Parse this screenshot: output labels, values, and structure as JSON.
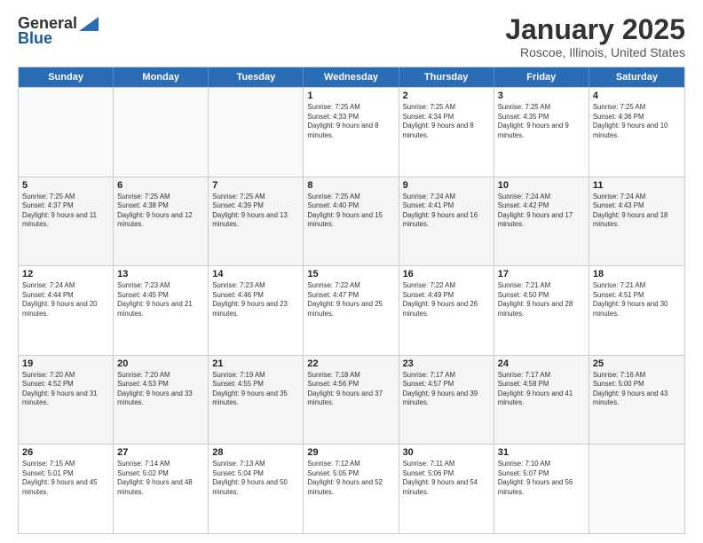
{
  "logo": {
    "general": "General",
    "blue": "Blue"
  },
  "title": "January 2025",
  "subtitle": "Roscoe, Illinois, United States",
  "headers": [
    "Sunday",
    "Monday",
    "Tuesday",
    "Wednesday",
    "Thursday",
    "Friday",
    "Saturday"
  ],
  "weeks": [
    [
      {
        "day": "",
        "sunrise": "",
        "sunset": "",
        "daylight": "",
        "empty": true
      },
      {
        "day": "",
        "sunrise": "",
        "sunset": "",
        "daylight": "",
        "empty": true
      },
      {
        "day": "",
        "sunrise": "",
        "sunset": "",
        "daylight": "",
        "empty": true
      },
      {
        "day": "1",
        "sunrise": "Sunrise: 7:25 AM",
        "sunset": "Sunset: 4:33 PM",
        "daylight": "Daylight: 9 hours and 8 minutes.",
        "empty": false
      },
      {
        "day": "2",
        "sunrise": "Sunrise: 7:25 AM",
        "sunset": "Sunset: 4:34 PM",
        "daylight": "Daylight: 9 hours and 8 minutes.",
        "empty": false
      },
      {
        "day": "3",
        "sunrise": "Sunrise: 7:25 AM",
        "sunset": "Sunset: 4:35 PM",
        "daylight": "Daylight: 9 hours and 9 minutes.",
        "empty": false
      },
      {
        "day": "4",
        "sunrise": "Sunrise: 7:25 AM",
        "sunset": "Sunset: 4:36 PM",
        "daylight": "Daylight: 9 hours and 10 minutes.",
        "empty": false
      }
    ],
    [
      {
        "day": "5",
        "sunrise": "Sunrise: 7:25 AM",
        "sunset": "Sunset: 4:37 PM",
        "daylight": "Daylight: 9 hours and 11 minutes.",
        "empty": false
      },
      {
        "day": "6",
        "sunrise": "Sunrise: 7:25 AM",
        "sunset": "Sunset: 4:38 PM",
        "daylight": "Daylight: 9 hours and 12 minutes.",
        "empty": false
      },
      {
        "day": "7",
        "sunrise": "Sunrise: 7:25 AM",
        "sunset": "Sunset: 4:39 PM",
        "daylight": "Daylight: 9 hours and 13 minutes.",
        "empty": false
      },
      {
        "day": "8",
        "sunrise": "Sunrise: 7:25 AM",
        "sunset": "Sunset: 4:40 PM",
        "daylight": "Daylight: 9 hours and 15 minutes.",
        "empty": false
      },
      {
        "day": "9",
        "sunrise": "Sunrise: 7:24 AM",
        "sunset": "Sunset: 4:41 PM",
        "daylight": "Daylight: 9 hours and 16 minutes.",
        "empty": false
      },
      {
        "day": "10",
        "sunrise": "Sunrise: 7:24 AM",
        "sunset": "Sunset: 4:42 PM",
        "daylight": "Daylight: 9 hours and 17 minutes.",
        "empty": false
      },
      {
        "day": "11",
        "sunrise": "Sunrise: 7:24 AM",
        "sunset": "Sunset: 4:43 PM",
        "daylight": "Daylight: 9 hours and 18 minutes.",
        "empty": false
      }
    ],
    [
      {
        "day": "12",
        "sunrise": "Sunrise: 7:24 AM",
        "sunset": "Sunset: 4:44 PM",
        "daylight": "Daylight: 9 hours and 20 minutes.",
        "empty": false
      },
      {
        "day": "13",
        "sunrise": "Sunrise: 7:23 AM",
        "sunset": "Sunset: 4:45 PM",
        "daylight": "Daylight: 9 hours and 21 minutes.",
        "empty": false
      },
      {
        "day": "14",
        "sunrise": "Sunrise: 7:23 AM",
        "sunset": "Sunset: 4:46 PM",
        "daylight": "Daylight: 9 hours and 23 minutes.",
        "empty": false
      },
      {
        "day": "15",
        "sunrise": "Sunrise: 7:22 AM",
        "sunset": "Sunset: 4:47 PM",
        "daylight": "Daylight: 9 hours and 25 minutes.",
        "empty": false
      },
      {
        "day": "16",
        "sunrise": "Sunrise: 7:22 AM",
        "sunset": "Sunset: 4:49 PM",
        "daylight": "Daylight: 9 hours and 26 minutes.",
        "empty": false
      },
      {
        "day": "17",
        "sunrise": "Sunrise: 7:21 AM",
        "sunset": "Sunset: 4:50 PM",
        "daylight": "Daylight: 9 hours and 28 minutes.",
        "empty": false
      },
      {
        "day": "18",
        "sunrise": "Sunrise: 7:21 AM",
        "sunset": "Sunset: 4:51 PM",
        "daylight": "Daylight: 9 hours and 30 minutes.",
        "empty": false
      }
    ],
    [
      {
        "day": "19",
        "sunrise": "Sunrise: 7:20 AM",
        "sunset": "Sunset: 4:52 PM",
        "daylight": "Daylight: 9 hours and 31 minutes.",
        "empty": false
      },
      {
        "day": "20",
        "sunrise": "Sunrise: 7:20 AM",
        "sunset": "Sunset: 4:53 PM",
        "daylight": "Daylight: 9 hours and 33 minutes.",
        "empty": false
      },
      {
        "day": "21",
        "sunrise": "Sunrise: 7:19 AM",
        "sunset": "Sunset: 4:55 PM",
        "daylight": "Daylight: 9 hours and 35 minutes.",
        "empty": false
      },
      {
        "day": "22",
        "sunrise": "Sunrise: 7:18 AM",
        "sunset": "Sunset: 4:56 PM",
        "daylight": "Daylight: 9 hours and 37 minutes.",
        "empty": false
      },
      {
        "day": "23",
        "sunrise": "Sunrise: 7:17 AM",
        "sunset": "Sunset: 4:57 PM",
        "daylight": "Daylight: 9 hours and 39 minutes.",
        "empty": false
      },
      {
        "day": "24",
        "sunrise": "Sunrise: 7:17 AM",
        "sunset": "Sunset: 4:58 PM",
        "daylight": "Daylight: 9 hours and 41 minutes.",
        "empty": false
      },
      {
        "day": "25",
        "sunrise": "Sunrise: 7:16 AM",
        "sunset": "Sunset: 5:00 PM",
        "daylight": "Daylight: 9 hours and 43 minutes.",
        "empty": false
      }
    ],
    [
      {
        "day": "26",
        "sunrise": "Sunrise: 7:15 AM",
        "sunset": "Sunset: 5:01 PM",
        "daylight": "Daylight: 9 hours and 45 minutes.",
        "empty": false
      },
      {
        "day": "27",
        "sunrise": "Sunrise: 7:14 AM",
        "sunset": "Sunset: 5:02 PM",
        "daylight": "Daylight: 9 hours and 48 minutes.",
        "empty": false
      },
      {
        "day": "28",
        "sunrise": "Sunrise: 7:13 AM",
        "sunset": "Sunset: 5:04 PM",
        "daylight": "Daylight: 9 hours and 50 minutes.",
        "empty": false
      },
      {
        "day": "29",
        "sunrise": "Sunrise: 7:12 AM",
        "sunset": "Sunset: 5:05 PM",
        "daylight": "Daylight: 9 hours and 52 minutes.",
        "empty": false
      },
      {
        "day": "30",
        "sunrise": "Sunrise: 7:11 AM",
        "sunset": "Sunset: 5:06 PM",
        "daylight": "Daylight: 9 hours and 54 minutes.",
        "empty": false
      },
      {
        "day": "31",
        "sunrise": "Sunrise: 7:10 AM",
        "sunset": "Sunset: 5:07 PM",
        "daylight": "Daylight: 9 hours and 56 minutes.",
        "empty": false
      },
      {
        "day": "",
        "sunrise": "",
        "sunset": "",
        "daylight": "",
        "empty": true
      }
    ]
  ]
}
